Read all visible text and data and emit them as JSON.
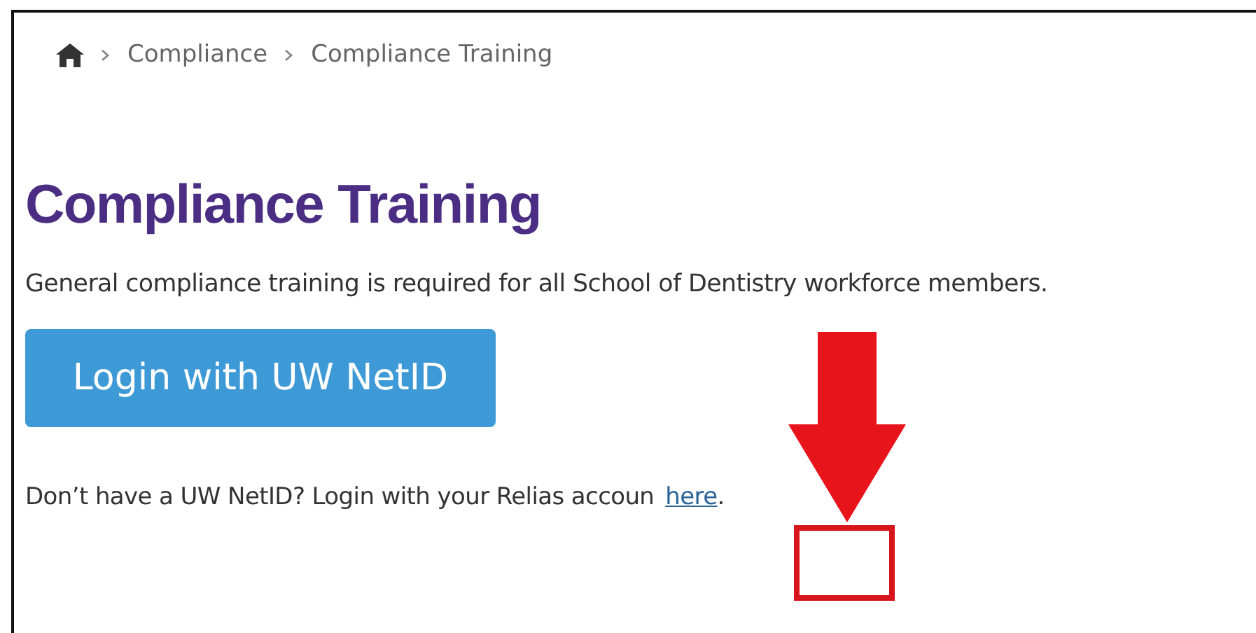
{
  "breadcrumb": [
    {
      "label": "Compliance"
    },
    {
      "label": "Compliance Training"
    }
  ],
  "title": "Compliance Training",
  "intro": "General compliance training is required for all School of Dentistry workforce members.",
  "login_button": "Login with UW NetID",
  "help_text": {
    "before": "Don’t have a UW NetID? Login with your Relias accoun",
    "link": "here",
    "after": "."
  }
}
